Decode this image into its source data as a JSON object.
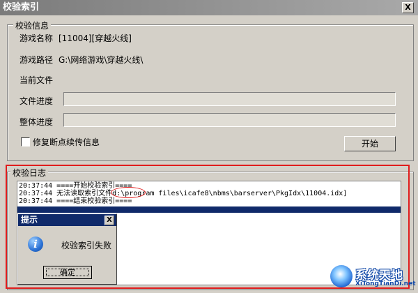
{
  "window": {
    "title": "校验索引",
    "close": "X"
  },
  "info": {
    "group_label": "校验信息",
    "game_name_label": "游戏名称",
    "game_name_value": "[11004][穿越火线]",
    "game_path_label": "游戏路径",
    "game_path_value": "G:\\网络游戏\\穿越火线\\",
    "current_file_label": "当前文件",
    "current_file_value": "",
    "file_progress_label": "文件进度",
    "file_progress": 0,
    "overall_progress_label": "整体进度",
    "overall_progress": 0,
    "resume_checkbox_label": "修复断点续传信息",
    "resume_checked": false,
    "start_button": "开始"
  },
  "log": {
    "group_label": "校验日志",
    "lines": [
      "20:37:44 ====开始校验索引====",
      "20:37:44 无法读取索引文件d:\\program files\\icafe8\\nbms\\barserver\\PkgIdx\\11004.idx]",
      "20:37:44 ====结束校验索引===="
    ],
    "highlight_color": "#e01c1c"
  },
  "dialog": {
    "title": "提示",
    "close": "X",
    "icon": "info-icon",
    "message": "校验索引失败",
    "ok_button": "确定"
  },
  "watermark": {
    "main": "系统天地",
    "sub": "XiTongTianDi.net"
  }
}
